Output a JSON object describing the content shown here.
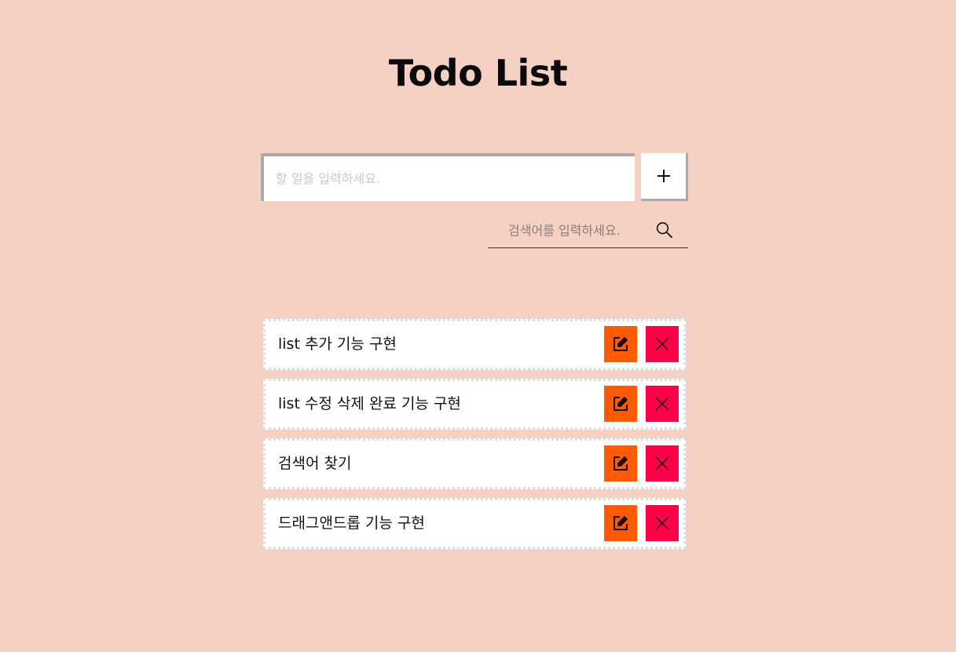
{
  "header": {
    "title": "Todo List"
  },
  "add_form": {
    "placeholder": "할 일을 입력하세요.",
    "value": "",
    "add_icon": "plus-icon"
  },
  "search": {
    "placeholder": "검색어를 입력하세요.",
    "value": "",
    "search_icon": "search-icon"
  },
  "todos": [
    {
      "text": "list 추가 기능 구현",
      "edit_icon": "edit-icon",
      "delete_icon": "close-icon"
    },
    {
      "text": "list 수정 삭제 완료 기능 구현",
      "edit_icon": "edit-icon",
      "delete_icon": "close-icon"
    },
    {
      "text": "검색어 찾기",
      "edit_icon": "edit-icon",
      "delete_icon": "close-icon"
    },
    {
      "text": "드래그앤드롭 기능 구현",
      "edit_icon": "edit-icon",
      "delete_icon": "close-icon"
    }
  ],
  "colors": {
    "background": "#f4d0c5",
    "edit_button": "#ff5a00",
    "delete_button": "#ff0048",
    "card": "#ffffff"
  }
}
